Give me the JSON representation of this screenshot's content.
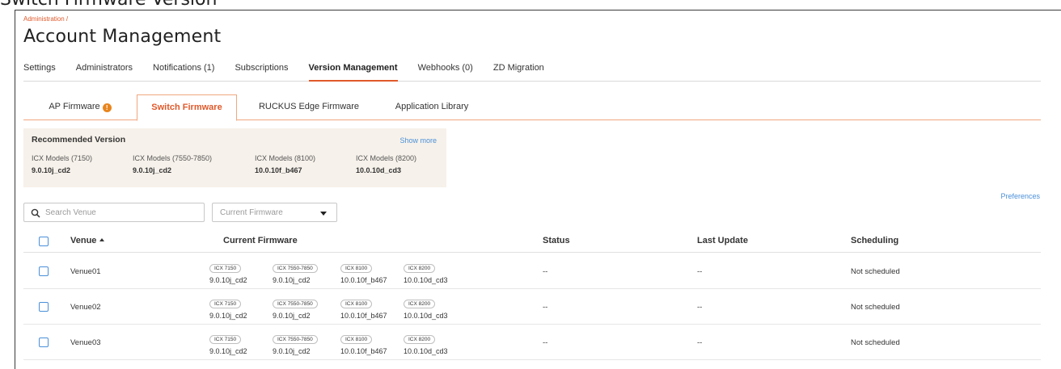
{
  "doc_heading": "Switch Firmware Version",
  "breadcrumb": "Administration /",
  "page_title": "Account Management",
  "main_tabs": [
    {
      "label": "Settings"
    },
    {
      "label": "Administrators"
    },
    {
      "label": "Notifications (1)"
    },
    {
      "label": "Subscriptions"
    },
    {
      "label": "Version Management",
      "active": true
    },
    {
      "label": "Webhooks (0)"
    },
    {
      "label": "ZD Migration"
    }
  ],
  "sub_tabs": [
    {
      "label": "AP Firmware",
      "badge": "!"
    },
    {
      "label": "Switch Firmware",
      "active": true
    },
    {
      "label": "RUCKUS Edge Firmware"
    },
    {
      "label": "Application Library"
    }
  ],
  "recommended": {
    "title": "Recommended Version",
    "show_more": "Show more",
    "models": [
      {
        "model": "ICX Models (7150)",
        "version": "9.0.10j_cd2"
      },
      {
        "model": "ICX Models (7550-7850)",
        "version": "9.0.10j_cd2"
      },
      {
        "model": "ICX Models (8100)",
        "version": "10.0.10f_b467"
      },
      {
        "model": "ICX Models (8200)",
        "version": "10.0.10d_cd3"
      }
    ]
  },
  "preferences_label": "Preferences",
  "search": {
    "placeholder": "Search Venue",
    "value": ""
  },
  "firmware_filter": {
    "value": "Current Firmware"
  },
  "table": {
    "headers": {
      "venue": "Venue",
      "current_firmware": "Current Firmware",
      "status": "Status",
      "last_update": "Last Update",
      "scheduling": "Scheduling"
    },
    "rows": [
      {
        "venue": "Venue01",
        "firmware": [
          {
            "model": "ICX 7150",
            "version": "9.0.10j_cd2"
          },
          {
            "model": "ICX 7550-7850",
            "version": "9.0.10j_cd2"
          },
          {
            "model": "ICX 8100",
            "version": "10.0.10f_b467"
          },
          {
            "model": "ICX 8200",
            "version": "10.0.10d_cd3"
          }
        ],
        "status": "--",
        "last_update": "--",
        "scheduling": "Not scheduled"
      },
      {
        "venue": "Venue02",
        "firmware": [
          {
            "model": "ICX 7150",
            "version": "9.0.10j_cd2"
          },
          {
            "model": "ICX 7550-7850",
            "version": "9.0.10j_cd2"
          },
          {
            "model": "ICX 8100",
            "version": "10.0.10f_b467"
          },
          {
            "model": "ICX 8200",
            "version": "10.0.10d_cd3"
          }
        ],
        "status": "--",
        "last_update": "--",
        "scheduling": "Not scheduled"
      },
      {
        "venue": "Venue03",
        "firmware": [
          {
            "model": "ICX 7150",
            "version": "9.0.10j_cd2"
          },
          {
            "model": "ICX 7550-7850",
            "version": "9.0.10j_cd2"
          },
          {
            "model": "ICX 8100",
            "version": "10.0.10f_b467"
          },
          {
            "model": "ICX 8200",
            "version": "10.0.10d_cd3"
          }
        ],
        "status": "--",
        "last_update": "--",
        "scheduling": "Not scheduled"
      }
    ]
  },
  "colors": {
    "accent": "#e0592a",
    "link": "#4a90d9",
    "warning_badge": "#e8851e",
    "panel_bg": "#f6f1ea"
  }
}
